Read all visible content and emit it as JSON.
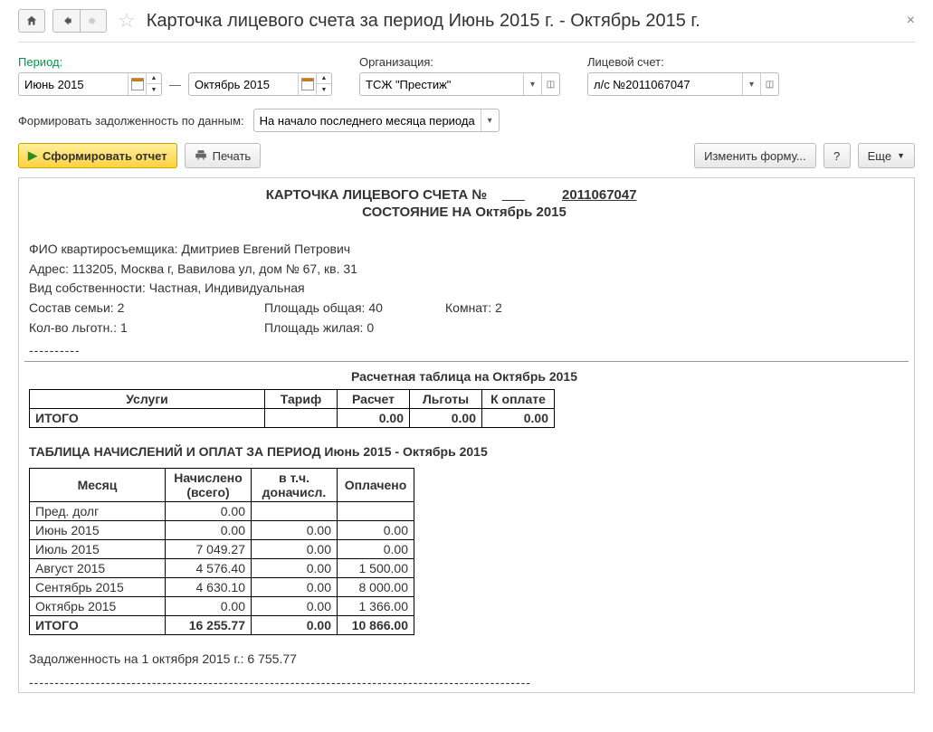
{
  "header": {
    "title": "Карточка лицевого счета за период Июнь 2015 г. - Октябрь 2015 г."
  },
  "filters": {
    "period_label": "Период:",
    "period_from": "Июнь 2015",
    "period_to": "Октябрь 2015",
    "dash": "—",
    "org_label": "Организация:",
    "org_value": "ТСЖ \"Престиж\"",
    "account_label": "Лицевой счет:",
    "account_value": "л/с №2011067047",
    "debt_basis_label": "Формировать задолженность по данным:",
    "debt_basis_value": "На начало последнего месяца периода"
  },
  "toolbar": {
    "generate": "Сформировать отчет",
    "print": "Печать",
    "change_form": "Изменить форму...",
    "help": "?",
    "more": "Еще"
  },
  "report": {
    "title_prefix": "КАРТОЧКА ЛИЦЕВОГО СЧЕТА №",
    "account_no": "2011067047",
    "state_prefix": "СОСТОЯНИЕ НА",
    "state_period": "Октябрь 2015",
    "info": {
      "fio_label": "ФИО квартиросъемщика:",
      "fio": "Дмитриев Евгений Петрович",
      "addr_label": "Адрес:",
      "addr": "113205, Москва г, Вавилова ул, дом № 67, кв. 31",
      "own_label": "Вид собственности:",
      "own": "Частная, Индивидуальная",
      "family_label": "Состав семьи:",
      "family": "2",
      "area_total_label": "Площадь общая:",
      "area_total": "40",
      "rooms_label": "Комнат:",
      "rooms": "2",
      "benefit_label": "Кол-во льготн.:",
      "benefit": "1",
      "area_live_label": "Площадь жилая:",
      "area_live": "0"
    },
    "dashes": "----------",
    "calc_table_title": "Расчетная таблица на Октябрь 2015",
    "calc_table": {
      "headers": [
        "Услуги",
        "Тариф",
        "Расчет",
        "Льготы",
        "К оплате"
      ],
      "total_label": "ИТОГО",
      "totals": [
        "0.00",
        "0.00",
        "0.00"
      ]
    },
    "charges_title": "ТАБЛИЦА НАЧИСЛЕНИЙ И ОПЛАТ ЗА ПЕРИОД Июнь 2015 - Октябрь 2015",
    "charges_table": {
      "headers": [
        "Месяц",
        "Начислено (всего)",
        "в т.ч. доначисл.",
        "Оплачено"
      ],
      "rows": [
        {
          "label": "Пред. долг",
          "charged": "0.00",
          "extra": "",
          "paid": ""
        },
        {
          "label": "Июнь 2015",
          "charged": "0.00",
          "extra": "0.00",
          "paid": "0.00"
        },
        {
          "label": "Июль 2015",
          "charged": "7 049.27",
          "extra": "0.00",
          "paid": "0.00"
        },
        {
          "label": "Август 2015",
          "charged": "4 576.40",
          "extra": "0.00",
          "paid": "1 500.00"
        },
        {
          "label": "Сентябрь 2015",
          "charged": "4 630.10",
          "extra": "0.00",
          "paid": "8 000.00"
        },
        {
          "label": "Октябрь 2015",
          "charged": "0.00",
          "extra": "0.00",
          "paid": "1 366.00"
        }
      ],
      "total_label": "ИТОГО",
      "totals": [
        "16 255.77",
        "0.00",
        "10 866.00"
      ]
    },
    "debt_line": "Задолженность на 1 октября 2015 г.: 6 755.77",
    "dashes_long": "--------------------------------------------------------------------------------------------------"
  }
}
